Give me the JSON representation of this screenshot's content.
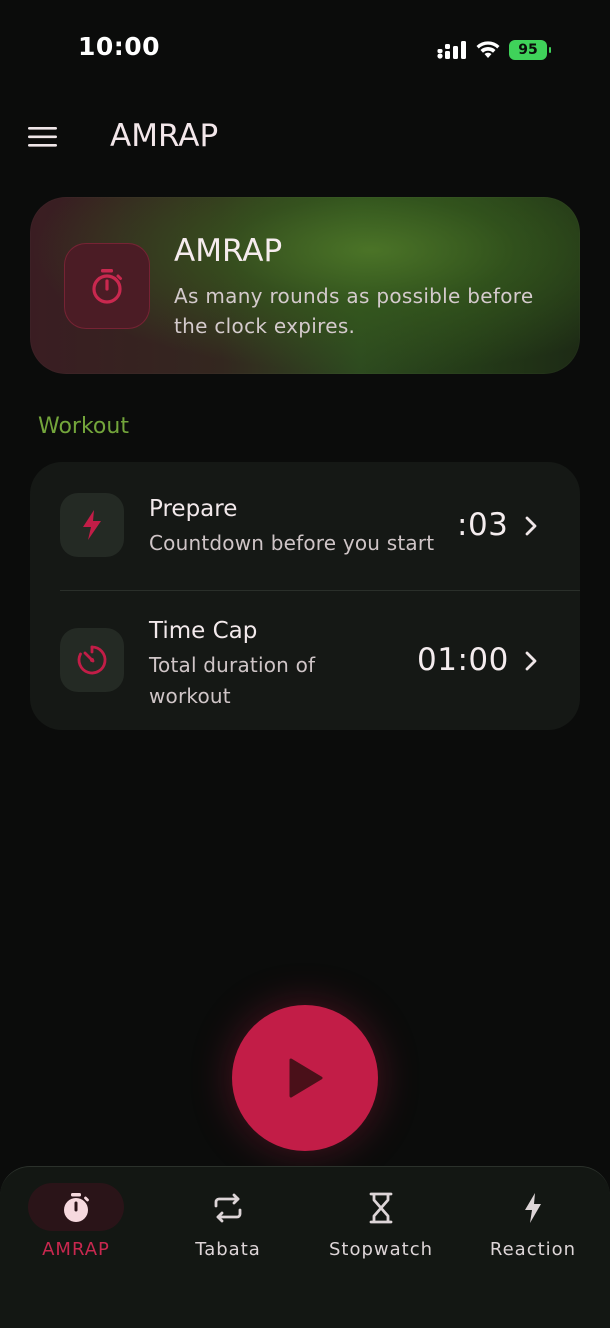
{
  "status_bar": {
    "time": "10:00",
    "battery": "95"
  },
  "app_bar": {
    "title": "AMRAP"
  },
  "hero": {
    "title": "AMRAP",
    "description": "As many rounds as possible before the clock expires."
  },
  "workout": {
    "section_label": "Workout",
    "rows": [
      {
        "title": "Prepare",
        "subtitle": "Countdown before you start",
        "value": ":03",
        "icon": "lightning-icon"
      },
      {
        "title": "Time Cap",
        "subtitle_line1": "Total duration of",
        "subtitle_line2": "workout",
        "value": "01:00",
        "icon": "timer-off-icon"
      }
    ]
  },
  "play": {
    "icon": "play-icon"
  },
  "nav": {
    "items": [
      {
        "label": "AMRAP",
        "icon": "stopwatch-icon",
        "active": true
      },
      {
        "label": "Tabata",
        "icon": "repeat-icon",
        "active": false
      },
      {
        "label": "Stopwatch",
        "icon": "hourglass-icon",
        "active": false
      },
      {
        "label": "Reaction",
        "icon": "lightning-icon",
        "active": false
      }
    ]
  },
  "colors": {
    "accent": "#c21d47",
    "section_label": "#73a53b",
    "background": "#0b0c0b"
  }
}
